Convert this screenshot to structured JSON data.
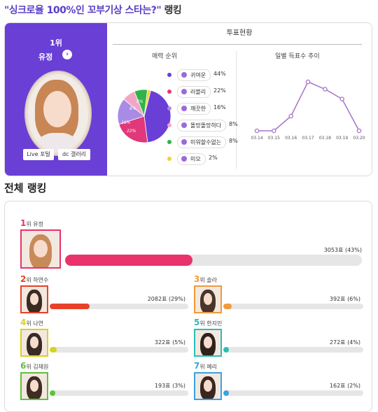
{
  "title": {
    "main": "\"싱크로율 100%인 꼬부기상 스타는?\"",
    "suffix": " 랭킹"
  },
  "left_panel": {
    "rank": "1위",
    "name": "유정",
    "arrow": "›",
    "buttons": [
      "Live 포털",
      "dc 갤러리"
    ],
    "accent": "#6a3fd6"
  },
  "vote_panel": {
    "title": "투표현황",
    "charm_title": "매력 순위",
    "trend_title": "일별 득표수 추이",
    "charm": [
      {
        "label": "귀여운",
        "pct": "44%",
        "value": 44,
        "color": "#6a3fd6"
      },
      {
        "label": "러블리",
        "pct": "22%",
        "value": 22,
        "color": "#e0387a"
      },
      {
        "label": "깨끗한",
        "pct": "16%",
        "value": 16,
        "color": "#a98be6"
      },
      {
        "label": "똘망똘망하다",
        "pct": "8%",
        "value": 8,
        "color": "#f1a7c3"
      },
      {
        "label": "미워할수없는",
        "pct": "8%",
        "value": 8,
        "color": "#2fb34a"
      },
      {
        "label": "미모",
        "pct": "2%",
        "value": 2,
        "color": "#f2d22e"
      }
    ],
    "pie_labels": [
      "22%",
      "16%",
      "8%",
      "8%"
    ],
    "trend": {
      "dates": [
        "03.14",
        "03.15",
        "03.16",
        "03.17",
        "03.18",
        "03.19",
        "03.20"
      ],
      "values": [
        0,
        0,
        30,
        100,
        85,
        65,
        0
      ],
      "color": "#a872c8"
    }
  },
  "section_title": "전체 랭킹",
  "ranking": [
    {
      "num": "1",
      "rank_text": "위 유정",
      "votes": "3053표 (43%)",
      "share": 43,
      "color": "#e8336b",
      "hair": "#c98a5a"
    },
    {
      "num": "2",
      "rank_text": "위 하연수",
      "votes": "2082표 (29%)",
      "share": 29,
      "color": "#e8412a",
      "hair": "#3a2a22"
    },
    {
      "num": "3",
      "rank_text": "위 솔라",
      "votes": "392표 (6%)",
      "share": 6,
      "color": "#f09a3c",
      "hair": "#4a352b"
    },
    {
      "num": "4",
      "rank_text": "위 나연",
      "votes": "322표 (5%)",
      "share": 5,
      "color": "#d9d21f",
      "hair": "#3a2a24"
    },
    {
      "num": "5",
      "rank_text": "위 한지민",
      "votes": "272표 (4%)",
      "share": 4,
      "color": "#2bbdb6",
      "hair": "#2e221d"
    },
    {
      "num": "6",
      "rank_text": "위 김채원",
      "votes": "193표 (3%)",
      "share": 3,
      "color": "#5fc13a",
      "hair": "#3f2c22"
    },
    {
      "num": "7",
      "rank_text": "위 예리",
      "votes": "162표 (2%)",
      "share": 2,
      "color": "#3aa3e0",
      "hair": "#3a2820"
    }
  ]
}
